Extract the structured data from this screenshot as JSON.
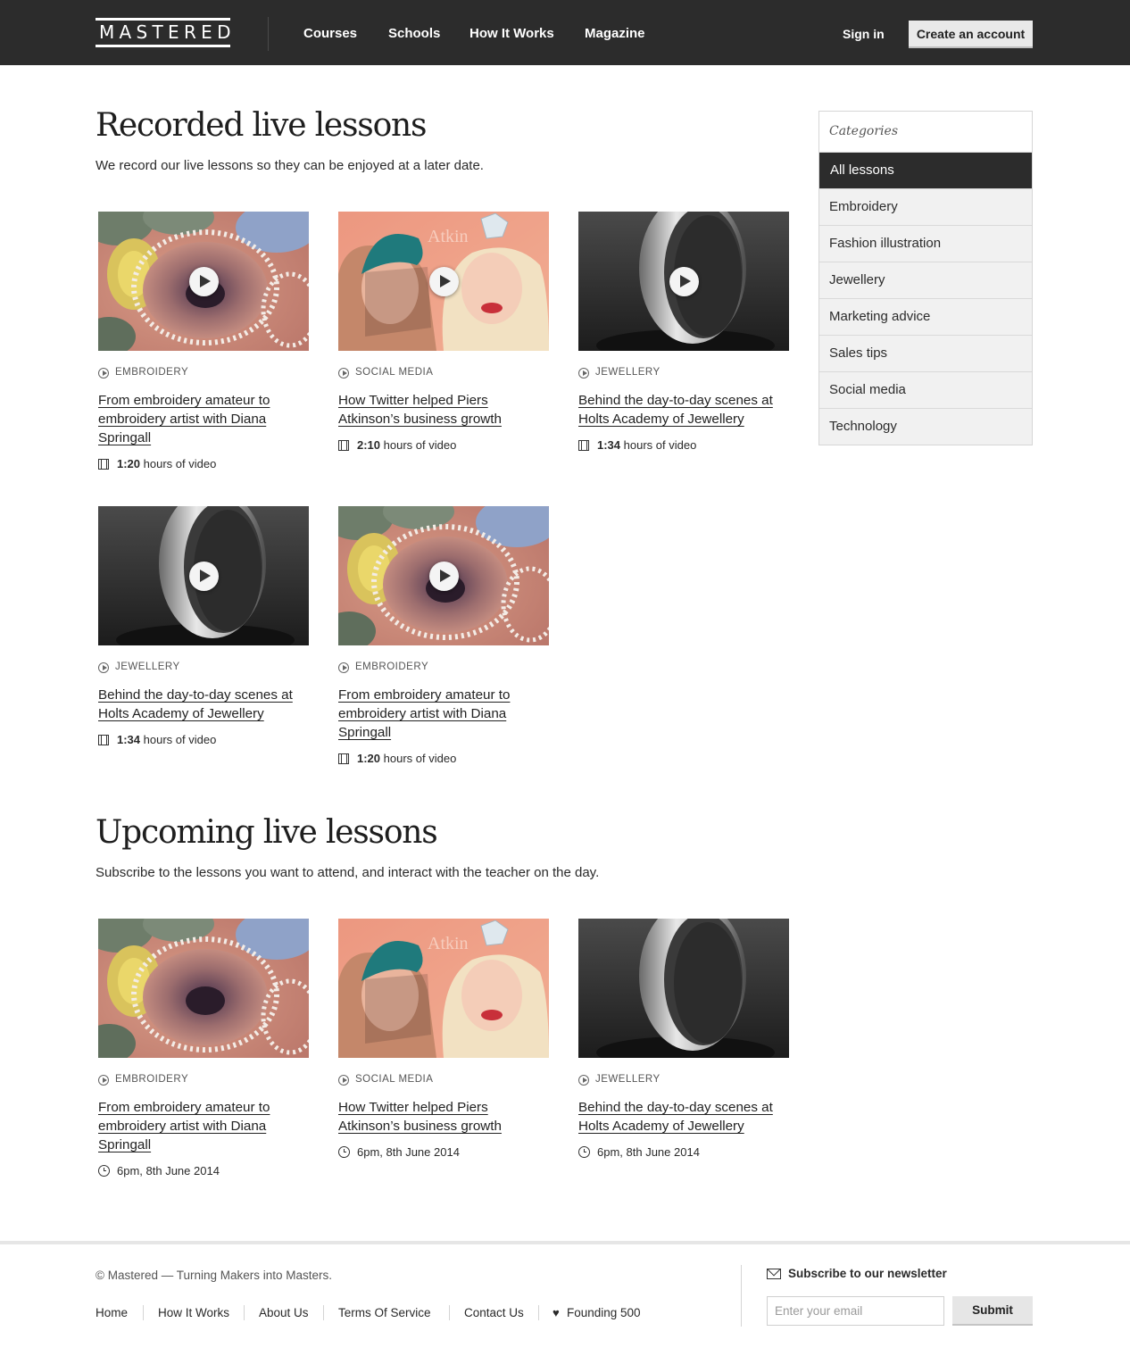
{
  "header": {
    "logo": "MASTERED",
    "nav": [
      "Courses",
      "Schools",
      "How It Works",
      "Magazine"
    ],
    "sign_in": "Sign in",
    "create_account": "Create an account"
  },
  "recorded": {
    "heading": "Recorded live lessons",
    "lead": "We record our live lessons so they can be enjoyed at a later date.",
    "cards": [
      {
        "image": "embroidery",
        "category": "EMBROIDERY",
        "title": "From embroidery amateur to embroidery artist with Diana Springall",
        "duration": "1:20",
        "duration_suffix": "hours of video"
      },
      {
        "image": "social",
        "category": "SOCIAL MEDIA",
        "title": "How Twitter helped Piers Atkinson’s business growth",
        "duration": "2:10",
        "duration_suffix": "hours of video"
      },
      {
        "image": "ring",
        "category": "JEWELLERY",
        "title": "Behind the day-to-day scenes at Holts Academy of Jewellery",
        "duration": "1:34",
        "duration_suffix": "hours of video"
      },
      {
        "image": "ring",
        "category": "JEWELLERY",
        "title": "Behind the day-to-day scenes at Holts Academy of Jewellery",
        "duration": "1:34",
        "duration_suffix": "hours of video"
      },
      {
        "image": "embroidery",
        "category": "EMBROIDERY",
        "title": "From embroidery amateur to embroidery artist with Diana Springall",
        "duration": "1:20",
        "duration_suffix": "hours of video"
      }
    ]
  },
  "upcoming": {
    "heading": "Upcoming live lessons",
    "lead": "Subscribe to the lessons you want to attend, and interact with the teacher on the day.",
    "cards": [
      {
        "image": "embroidery",
        "category": "EMBROIDERY",
        "title": "From embroidery amateur to embroidery artist with Diana Springall",
        "time": "6pm, 8th June 2014"
      },
      {
        "image": "social",
        "category": "SOCIAL MEDIA",
        "title": "How Twitter helped Piers Atkinson’s business growth",
        "time": "6pm, 8th June 2014"
      },
      {
        "image": "ring",
        "category": "JEWELLERY",
        "title": "Behind the day-to-day scenes at Holts Academy of Jewellery",
        "time": "6pm, 8th June 2014"
      }
    ]
  },
  "sidebar": {
    "heading": "Categories",
    "items": [
      "All lessons",
      "Embroidery",
      "Fashion illustration",
      "Jewellery",
      "Marketing advice",
      "Sales tips",
      "Social media",
      "Technology"
    ],
    "active": "All lessons"
  },
  "footer": {
    "copyright": "© Mastered — Turning Makers into Masters.",
    "links": [
      "Home",
      "How It Works",
      "About Us",
      "Terms Of Service",
      "Contact Us"
    ],
    "founding": "Founding 500",
    "newsletter_label": "Subscribe to our newsletter",
    "email_placeholder": "Enter your email",
    "submit": "Submit"
  },
  "colors": {
    "header_bg": "#2c2c2c",
    "active_category_bg": "#2c2c2c",
    "category_bg": "#f1f1f1",
    "button_bg": "#e9e9e9"
  }
}
